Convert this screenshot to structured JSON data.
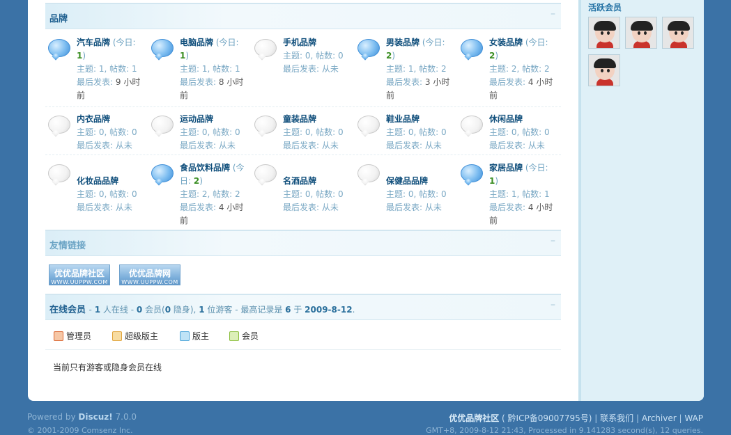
{
  "brands": {
    "title": "品牌",
    "collapse": "–",
    "forums": [
      {
        "name": "汽车品牌",
        "today_prefix": "(今日: ",
        "today": "1",
        "today_suffix": ")",
        "topics": "主题: 1, 帖数: 1",
        "last_label": "最后发表:",
        "last": "9 小时前",
        "icon": "new"
      },
      {
        "name": "电脑品牌",
        "today_prefix": "(今日: ",
        "today": "1",
        "today_suffix": ")",
        "topics": "主题: 1, 帖数: 1",
        "last_label": "最后发表:",
        "last": "8 小时前",
        "icon": "new"
      },
      {
        "name": "手机品牌",
        "today_prefix": "",
        "today": "",
        "today_suffix": "",
        "topics": "主题: 0, 帖数: 0",
        "last_label": "最后发表: 从未",
        "last": "",
        "icon": "old"
      },
      {
        "name": "男装品牌",
        "today_prefix": "(今日: ",
        "today": "2",
        "today_suffix": ")",
        "topics": "主题: 1, 帖数: 2",
        "last_label": "最后发表:",
        "last": "3 小时前",
        "icon": "new"
      },
      {
        "name": "女装品牌",
        "today_prefix": "(今日: ",
        "today": "2",
        "today_suffix": ")",
        "topics": "主题: 2, 帖数: 2",
        "last_label": "最后发表:",
        "last": "4 小时前",
        "icon": "new"
      },
      {
        "name": "内衣品牌",
        "today_prefix": "",
        "today": "",
        "today_suffix": "",
        "topics": "主题: 0, 帖数: 0",
        "last_label": "最后发表: 从未",
        "last": "",
        "icon": "old"
      },
      {
        "name": "运动品牌",
        "today_prefix": "",
        "today": "",
        "today_suffix": "",
        "topics": "主题: 0, 帖数: 0",
        "last_label": "最后发表: 从未",
        "last": "",
        "icon": "old"
      },
      {
        "name": "童装品牌",
        "today_prefix": "",
        "today": "",
        "today_suffix": "",
        "topics": "主题: 0, 帖数: 0",
        "last_label": "最后发表: 从未",
        "last": "",
        "icon": "old"
      },
      {
        "name": "鞋业品牌",
        "today_prefix": "",
        "today": "",
        "today_suffix": "",
        "topics": "主题: 0, 帖数: 0",
        "last_label": "最后发表: 从未",
        "last": "",
        "icon": "old"
      },
      {
        "name": "休闲品牌",
        "today_prefix": "",
        "today": "",
        "today_suffix": "",
        "topics": "主题: 0, 帖数: 0",
        "last_label": "最后发表: 从未",
        "last": "",
        "icon": "old"
      },
      {
        "name": "化妆品品牌",
        "today_prefix": "",
        "today": "",
        "today_suffix": "",
        "topics": "主题: 0, 帖数: 0",
        "last_label": "最后发表: 从未",
        "last": "",
        "icon": "old"
      },
      {
        "name": "食品饮料品牌",
        "today_prefix": "(今日: ",
        "today": "2",
        "today_suffix": ")",
        "topics": "主题: 2, 帖数: 2",
        "last_label": "最后发表:",
        "last": "4 小时前",
        "icon": "new"
      },
      {
        "name": "名酒品牌",
        "today_prefix": "",
        "today": "",
        "today_suffix": "",
        "topics": "主题: 0, 帖数: 0",
        "last_label": "最后发表: 从未",
        "last": "",
        "icon": "old"
      },
      {
        "name": "保健品品牌",
        "today_prefix": "",
        "today": "",
        "today_suffix": "",
        "topics": "主题: 0, 帖数: 0",
        "last_label": "最后发表: 从未",
        "last": "",
        "icon": "old"
      },
      {
        "name": "家居品牌",
        "today_prefix": "(今日: ",
        "today": "1",
        "today_suffix": ")",
        "topics": "主题: 1, 帖数: 1",
        "last_label": "最后发表:",
        "last": "4 小时前",
        "icon": "new"
      }
    ]
  },
  "friend_links": {
    "title": "友情链接",
    "collapse": "–",
    "items": [
      {
        "label": "优优品牌社区",
        "sub": "WWW.UUPPW.COM"
      },
      {
        "label": "优优品牌网",
        "sub": "WWW.UUPPW.COM"
      }
    ]
  },
  "online": {
    "title": "在线会员",
    "collapse": "–",
    "summary_parts": [
      "- ",
      "1",
      " 人在线 - ",
      "0",
      " 会员(",
      "0",
      " 隐身), ",
      "1",
      " 位游客 - 最高记录是 ",
      "6",
      " 于 ",
      "2009-8-12",
      "."
    ],
    "legend": [
      {
        "label": "管理员",
        "color": "#d9642f"
      },
      {
        "label": "超级版主",
        "color": "#e0a33a"
      },
      {
        "label": "版主",
        "color": "#4aa3d8"
      },
      {
        "label": "会员",
        "color": "#8cbf3f"
      }
    ],
    "note": "当前只有游客或隐身会员在线"
  },
  "sidebar": {
    "title": "活跃会员",
    "avatar_count": 4
  },
  "footer": {
    "powered_prefix": "Powered by ",
    "powered_brand": "Discuz!",
    "powered_version": " 7.0.0",
    "copyright": "© 2001-2009 Comsenz Inc.",
    "site_name": "优优品牌社区",
    "icp": "( 黔ICP备09007795号)",
    "links": [
      "联系我们",
      "Archiver",
      "WAP"
    ],
    "stats": "GMT+8, 2009-8-12 21:43, Processed in 9.141283 second(s), 12 queries."
  }
}
